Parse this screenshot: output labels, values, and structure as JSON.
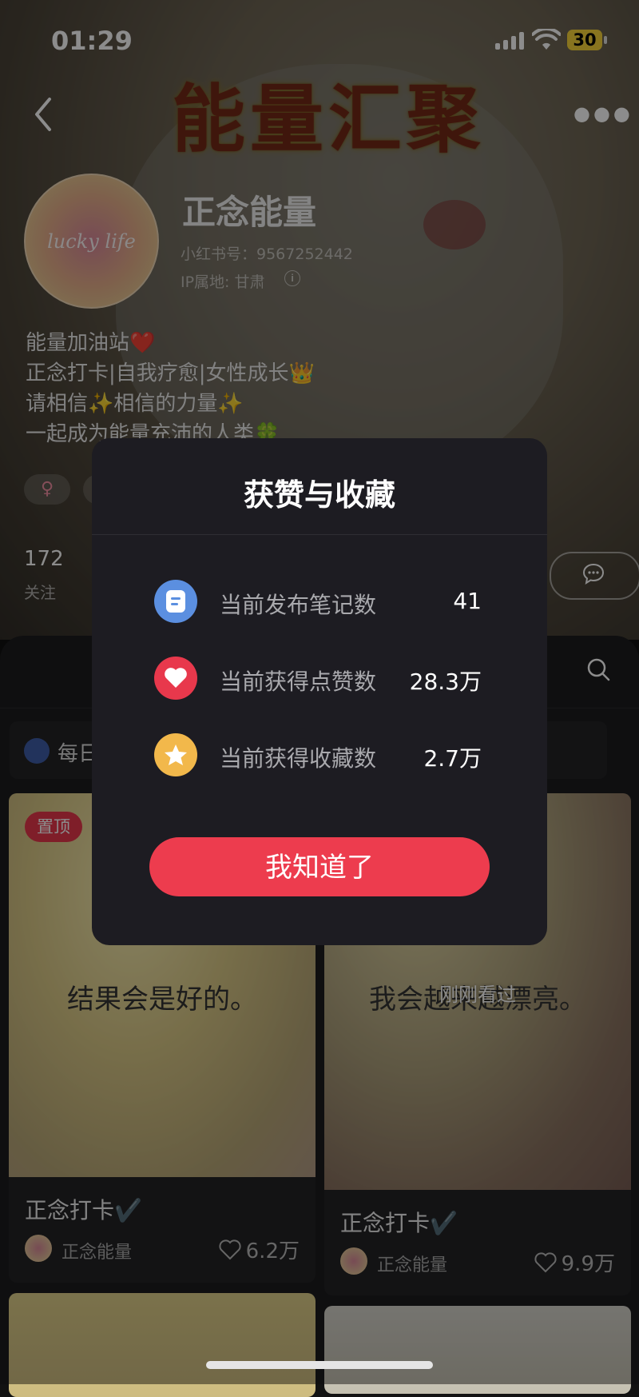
{
  "status_bar": {
    "time": "01:29",
    "battery": "30"
  },
  "cover": {
    "banner_text": "能量汇聚"
  },
  "profile": {
    "avatar_text": "lucky life",
    "nickname": "正念能量",
    "red_id": "小红书号：9567252442",
    "ip_location": "IP属地: 甘肃",
    "bio_lines": [
      "能量加油站❤️",
      "正念打卡|自我疗愈|女性成长👑",
      "请相信✨相信的力量✨",
      "一起成为能量充沛的人类🍀"
    ],
    "gender_tag": "♀",
    "following_count": "172",
    "following_label": "关注"
  },
  "collection": {
    "label": "每日"
  },
  "notes": [
    {
      "pinned_label": "置顶",
      "image_text": "结果会是好的。",
      "title": "正念打卡✔️",
      "author": "正念能量",
      "likes": "6.2万"
    },
    {
      "image_text": "我会越来越漂亮。",
      "overlay": "刚刚看过",
      "title": "正念打卡✔️",
      "author": "正念能量",
      "likes": "9.9万"
    }
  ],
  "dialog": {
    "title": "获赞与收藏",
    "rows": [
      {
        "icon": "note-icon",
        "color": "#5b8fe0",
        "label": "当前发布笔记数",
        "value": "41"
      },
      {
        "icon": "heart-icon",
        "color": "#e8384c",
        "label": "当前获得点赞数",
        "value": "28.3万"
      },
      {
        "icon": "star-icon",
        "color": "#f2b84b",
        "label": "当前获得收藏数",
        "value": "2.7万"
      }
    ],
    "ok_label": "我知道了"
  }
}
